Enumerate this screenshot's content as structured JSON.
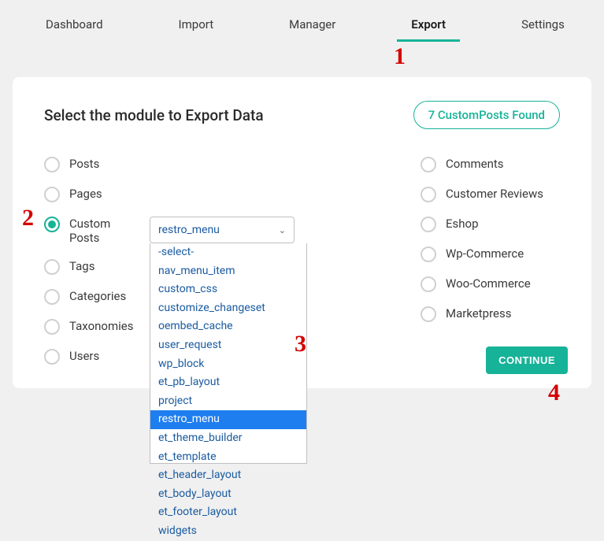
{
  "tabs": {
    "dashboard": "Dashboard",
    "import": "Import",
    "manager": "Manager",
    "export": "Export",
    "settings": "Settings"
  },
  "card": {
    "title": "Select the module to Export Data",
    "found_badge": "7 CustomPosts Found",
    "continue": "CONTINUE"
  },
  "left_options": {
    "posts": "Posts",
    "pages": "Pages",
    "custom_posts": "Custom Posts",
    "tags": "Tags",
    "categories": "Categories",
    "taxonomies": "Taxonomies",
    "users": "Users"
  },
  "right_options": {
    "comments": "Comments",
    "customer_reviews": "Customer Reviews",
    "eshop": "Eshop",
    "wp_commerce": "Wp-Commerce",
    "woo_commerce": "Woo-Commerce",
    "marketpress": "Marketpress"
  },
  "select": {
    "value": "restro_menu",
    "options": [
      "-select-",
      "nav_menu_item",
      "custom_css",
      "customize_changeset",
      "oembed_cache",
      "user_request",
      "wp_block",
      "et_pb_layout",
      "project",
      "restro_menu",
      "et_theme_builder",
      "et_template",
      "et_header_layout",
      "et_body_layout",
      "et_footer_layout",
      "widgets"
    ]
  },
  "annotations": {
    "a1": "1",
    "a2": "2",
    "a3": "3",
    "a4": "4"
  }
}
